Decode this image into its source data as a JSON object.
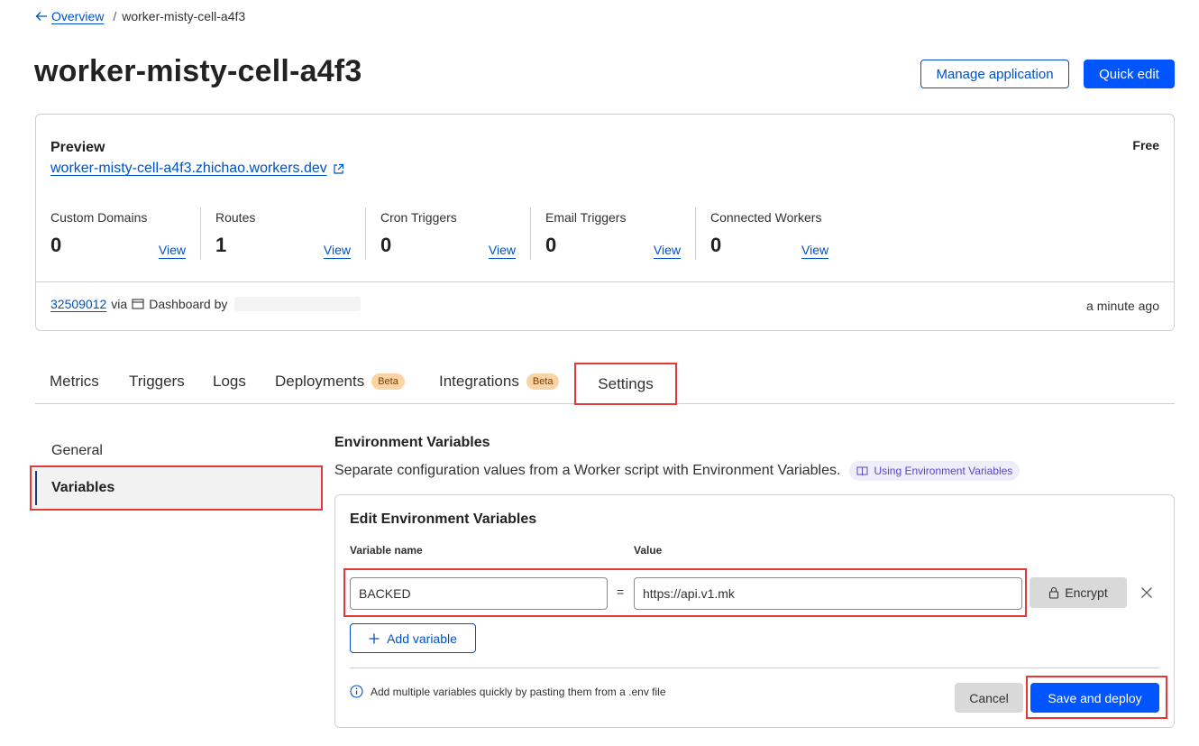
{
  "breadcrumb": {
    "back_label": "Overview",
    "separator": "/",
    "current": "worker-misty-cell-a4f3"
  },
  "header": {
    "title": "worker-misty-cell-a4f3",
    "manage_label": "Manage application",
    "quick_edit_label": "Quick edit"
  },
  "summary": {
    "preview_label": "Preview",
    "preview_url": "worker-misty-cell-a4f3.zhichao.workers.dev",
    "plan": "Free",
    "stats": [
      {
        "label": "Custom Domains",
        "value": "0",
        "action": "View"
      },
      {
        "label": "Routes",
        "value": "1",
        "action": "View"
      },
      {
        "label": "Cron Triggers",
        "value": "0",
        "action": "View"
      },
      {
        "label": "Email Triggers",
        "value": "0",
        "action": "View"
      },
      {
        "label": "Connected Workers",
        "value": "0",
        "action": "View"
      }
    ],
    "deployment": {
      "id": "32509012",
      "via": "via",
      "source": "Dashboard by",
      "time": "a minute ago"
    }
  },
  "tabs": {
    "metrics": "Metrics",
    "triggers": "Triggers",
    "logs": "Logs",
    "deployments": "Deployments",
    "deployments_badge": "Beta",
    "integrations": "Integrations",
    "integrations_badge": "Beta",
    "settings": "Settings",
    "active": "Settings"
  },
  "side_nav": {
    "general": "General",
    "variables": "Variables",
    "active": "Variables"
  },
  "env": {
    "title": "Environment Variables",
    "description": "Separate configuration values from a Worker script with Environment Variables.",
    "doc_link": "Using Environment Variables",
    "panel_title": "Edit Environment Variables",
    "col_name": "Variable name",
    "col_value": "Value",
    "equals": "=",
    "var_name": "BACKED",
    "var_value": "https://api.v1.mk",
    "encrypt_label": "Encrypt",
    "add_label": "Add variable",
    "hint": "Add multiple variables quickly by pasting them from a .env file",
    "cancel_label": "Cancel",
    "save_label": "Save and deploy"
  },
  "colors": {
    "link": "#0051c3",
    "primary": "#0055ff",
    "highlight": "#e03b3b",
    "badge_bg": "#fbd4a6"
  }
}
